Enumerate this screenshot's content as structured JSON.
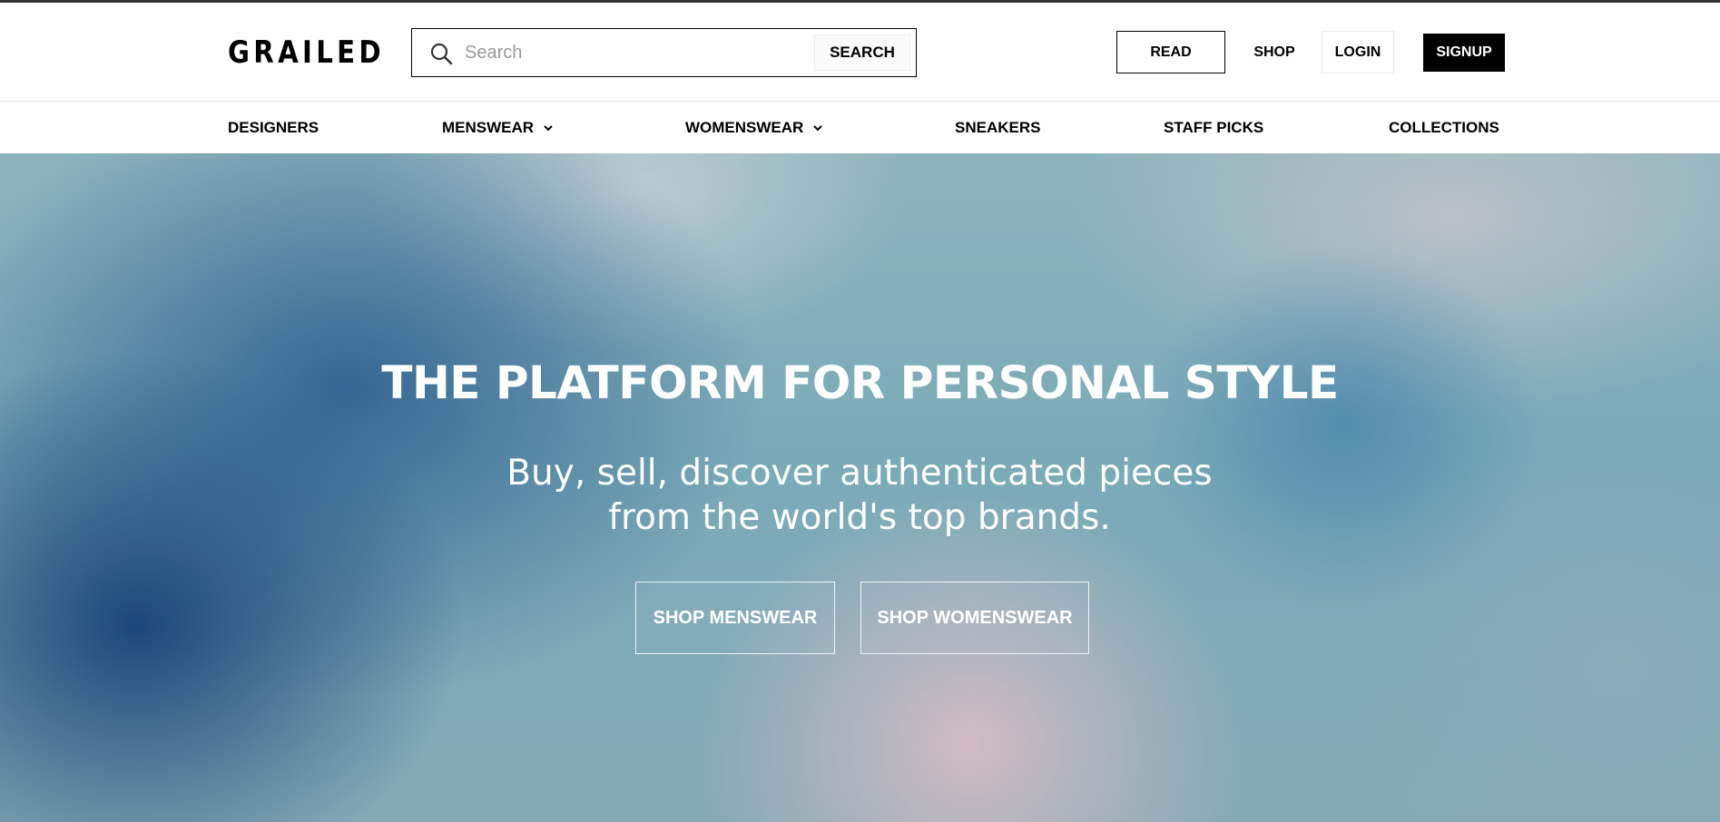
{
  "header": {
    "logo": "GRAILED",
    "search": {
      "placeholder": "Search",
      "value": "",
      "button_label": "SEARCH"
    },
    "read_label": "READ",
    "shop_label": "SHOP",
    "login_label": "LOGIN",
    "signup_label": "SIGNUP"
  },
  "nav": {
    "items": [
      {
        "label": "DESIGNERS",
        "has_dropdown": false
      },
      {
        "label": "MENSWEAR",
        "has_dropdown": true
      },
      {
        "label": "WOMENSWEAR",
        "has_dropdown": true
      },
      {
        "label": "SNEAKERS",
        "has_dropdown": false
      },
      {
        "label": "STAFF PICKS",
        "has_dropdown": false
      },
      {
        "label": "COLLECTIONS",
        "has_dropdown": false
      }
    ]
  },
  "hero": {
    "title": "THE PLATFORM FOR PERSONAL STYLE",
    "subtitle_line1": "Buy, sell, discover authenticated pieces",
    "subtitle_line2": "from the world's top brands.",
    "buttons": [
      {
        "label": "SHOP MENSWEAR"
      },
      {
        "label": "SHOP WOMENSWEAR"
      }
    ]
  },
  "colors": {
    "brand_black": "#000000",
    "header_bg": "#ffffff",
    "hero_text": "#ffffff"
  },
  "icons": {
    "search": "search-icon",
    "dropdown": "chevron-down-icon"
  }
}
